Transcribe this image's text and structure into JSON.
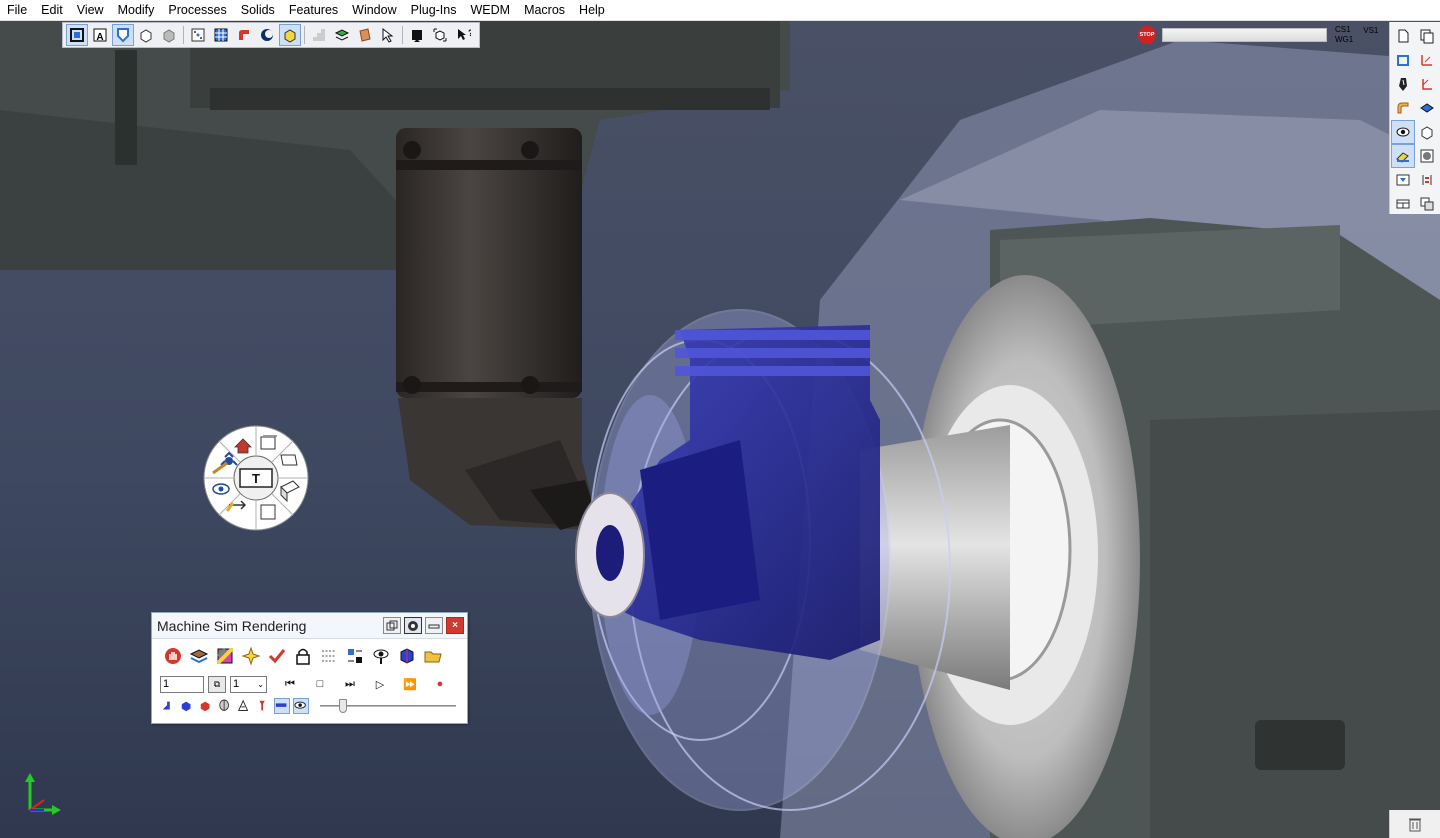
{
  "menu": {
    "items": [
      "File",
      "Edit",
      "View",
      "Modify",
      "Processes",
      "Solids",
      "Features",
      "Window",
      "Plug-Ins",
      "WEDM",
      "Macros",
      "Help"
    ]
  },
  "toolbar": {
    "buttons": [
      {
        "icon": "frame-select-icon",
        "active": true
      },
      {
        "icon": "text-a-icon",
        "active": false
      },
      {
        "icon": "shield-view-icon",
        "active": true
      },
      {
        "icon": "cube-wire-icon",
        "active": false
      },
      {
        "icon": "cube-solid-icon",
        "active": false
      },
      {
        "icon": "dot-grid-icon",
        "active": false
      },
      {
        "icon": "grid-icon",
        "active": false
      },
      {
        "icon": "elbow-pipe-icon",
        "active": false
      },
      {
        "icon": "crescent-icon",
        "active": false
      },
      {
        "icon": "cube-highlight-icon",
        "active": true
      },
      {
        "icon": "stairs-icon",
        "active": false
      },
      {
        "icon": "layer-stack-icon",
        "active": false
      },
      {
        "icon": "copper-stack-icon",
        "active": false
      },
      {
        "icon": "pointer-icon",
        "active": false
      },
      {
        "icon": "black-square-icon",
        "active": false
      },
      {
        "icon": "cube-arrows-icon",
        "active": false
      },
      {
        "icon": "help-pointer-icon",
        "active": false
      }
    ]
  },
  "status": {
    "stop_label": "STOP",
    "progress_fraction": 0.0,
    "coord_system": "CS1",
    "work_group": "WG1",
    "view_set": "VS1"
  },
  "right_toolbar": {
    "buttons": [
      {
        "icon": "new-page-icon",
        "active": false
      },
      {
        "icon": "copy-pages-icon",
        "active": false
      },
      {
        "icon": "select-rect-icon",
        "active": false
      },
      {
        "icon": "axes-red-icon",
        "active": false
      },
      {
        "icon": "pen-nib-icon",
        "active": false
      },
      {
        "icon": "angle-red-icon",
        "active": false
      },
      {
        "icon": "bend-pipe-icon",
        "active": false
      },
      {
        "icon": "surface-blue-icon",
        "active": false
      },
      {
        "icon": "eye-icon",
        "active": true
      },
      {
        "icon": "box-outline-icon",
        "active": false
      },
      {
        "icon": "eraser-icon",
        "active": true
      },
      {
        "icon": "sphere-box-icon",
        "active": false
      },
      {
        "icon": "table-filter-icon",
        "active": false
      },
      {
        "icon": "bracket-red-icon",
        "active": false
      },
      {
        "icon": "window-tile-icon",
        "active": false
      },
      {
        "icon": "stack-copy-icon",
        "active": false
      }
    ]
  },
  "view_wheel": {
    "center_label": "T"
  },
  "sim_panel": {
    "title": "Machine Sim Rendering",
    "frame_value": "1",
    "step_value": "1",
    "speed_fraction": 0.15,
    "tools_row": [
      "stop-hand-icon",
      "layers-icon",
      "color-swatch-icon",
      "spark-icon",
      "checkmark-icon",
      "lock-icon",
      "list-icon",
      "grid-ops-icon",
      "eye-magnify-icon",
      "blue-cube-icon",
      "open-folder-icon"
    ],
    "playback": [
      {
        "name": "rewind-button",
        "glyph": "⏮"
      },
      {
        "name": "stop-button",
        "glyph": "□"
      },
      {
        "name": "step-button",
        "glyph": "⏭"
      },
      {
        "name": "play-button",
        "glyph": "▷"
      },
      {
        "name": "fast-forward-button",
        "glyph": "⏩"
      },
      {
        "name": "record-button",
        "glyph": "●"
      }
    ],
    "display_row": [
      {
        "icon": "fixture-icon",
        "active": false
      },
      {
        "icon": "stock-blue-icon",
        "active": false
      },
      {
        "icon": "stock-red-icon",
        "active": false
      },
      {
        "icon": "cylinder-icon",
        "active": false
      },
      {
        "icon": "tool-holder-icon",
        "active": false
      },
      {
        "icon": "drill-red-icon",
        "active": false
      },
      {
        "icon": "path-line-icon",
        "active": true
      },
      {
        "icon": "eye-small-icon",
        "active": true
      }
    ]
  },
  "colors": {
    "background": "#3b4458",
    "part": "#2a2d9a",
    "stock_transparent": "#b9c0ee",
    "chuck": "#4a5252",
    "spindle": "#3a3634"
  }
}
